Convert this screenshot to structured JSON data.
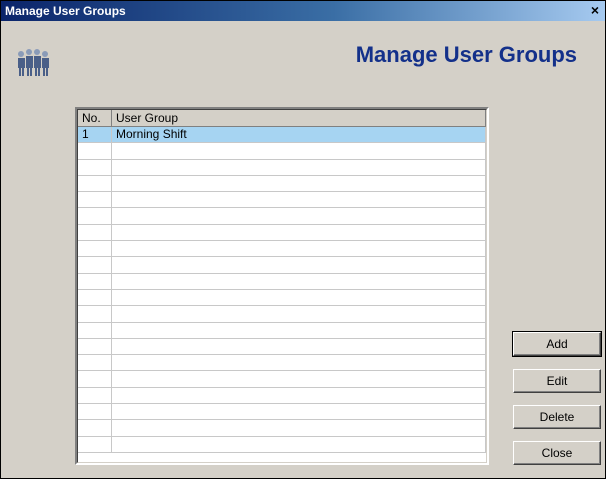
{
  "window": {
    "title": "Manage User Groups",
    "close_glyph": "×"
  },
  "header": {
    "title": "Manage User Groups",
    "icon": "users-group-icon"
  },
  "grid": {
    "columns": [
      "No.",
      "User Group"
    ],
    "rows": [
      {
        "no": "1",
        "group": "Morning Shift",
        "selected": true
      }
    ],
    "empty_rows": 19
  },
  "buttons": {
    "add": "Add",
    "edit": "Edit",
    "delete": "Delete",
    "close": "Close"
  },
  "colors": {
    "title_bar": "#0a246a",
    "header_text": "#13308a",
    "selection": "#a6d4f2"
  }
}
